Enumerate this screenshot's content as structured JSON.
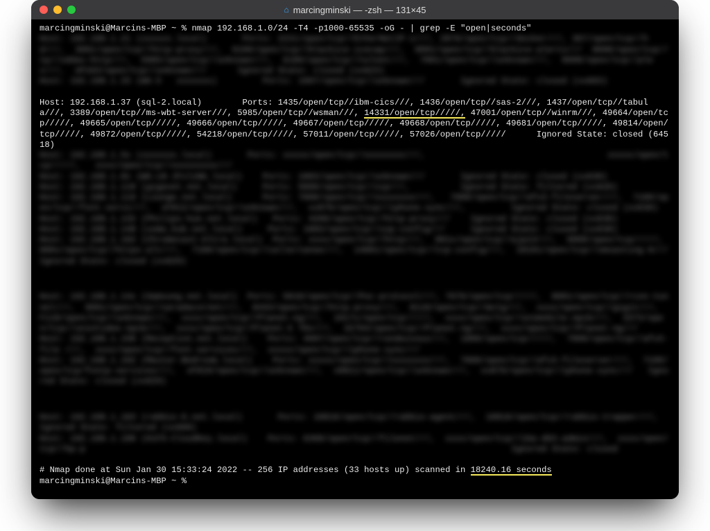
{
  "window": {
    "title": "marcingminski — -zsh — 131×45"
  },
  "terminal": {
    "prompt1_user": "marcingminski@Marcins-MBP ~ %",
    "command": "nmap 192.168.1.0/24 -T4 -p1000-65535 -oG - | grep -E \"open|seconds\"",
    "blurred1": "Host: 192.168.1.21 (xxxxxx.local)       Ports: 2221/open/tcp//EtherNetIP-1///, 2876/open/tcp//docker///, 367/open/tcp//hd///,  3001/open/tcp//http-proxy///,  6100/open/tcp//blackice-icecap///,  9091/open/tcp//blackice-alerts///  8008/open/tcp//tp//vddav-http///,  5985/open/tcp//unknown///,  6180/open/tcp//telnet///,  7001/open/tcp//unknown///,  8008/open/tcp//plex///,  eP163/open/tcp//unknown///      Ignored State: closed (xx623)\nHost: 192.168.1.33 (WG-5   xxxxxxx)         Ports: 1997/open/tcp//unknown///       Ignored State: closed (xx603)",
    "clear_host_line_part1": "Host: 192.168.1.37 (sql-2.local)        Ports: 1435/open/tcp//ibm-cics///, 1436/open/tcp//sas-2///, 1437/open/tcp//tabula///, 3389/open/tcp//ms-wbt-server///, 5985/open/tcp//wsman///,",
    "clear_host_hl1": "14331/open/tcp/////,",
    "clear_host_line_part2": "47001/open/tcp//winrm///, 49664/open/tcp/////, 49665/open/tcp/////, 49666/open/tcp/////, 49667/open/tcp/////, 49668/open/tcp/////, 49681/open/tcp/////, 49814/open/tcp/////, 49872/open/tcp/////, 54218/open/tcp/////, 57011/open/tcp/////, 57026/open/tcp/////      Ignored State: closed (64518)",
    "blurred2": "Host: 192.168.1.5x (xxxxxxx.local)       Ports: xxxxx/open/tcp//xxxxxxxx///,                                    xxxxx/open/tcp/////,   xxxx/open/tcp//xxxxxxxxx///\nHost: 192.168.1.8x (WG-LB-JFxlzNA.local)    Ports: 1883/open/tcp//unknown///       Ignored State: closed (xx638)\nHost: 192.168.1.118 (gigaset.net.local)     Ports: 5060/open/tcp//sip///,          Ignored State: filtered (xx620)\nHost: 192.168.1.119 (Lounge.net.local)      Ports: 7000/open/tcp//xxxxxxxx///,   7000/open/tcp//afx3-fileserver///,  7100/open/tcp//font-servi///,  xF812/open/tcp//unknown///,  xx876/open/tcp//iphone-sync///,         Ignored State: closed (xx630)\nHost: 192.168.1.132 (Philips-hue.net.local)   Ports: 4200/open/tcp//http-proxy///    Ignored State: closed (xx638)\nHost: 192.168.1.148 (some_hub.net.local)     Ports: 1883/open/tcp//ssp-config///     Ignored State: closed (xx638)\nHost: 192.168.1.162 (Chromecast-Ultra.local)  Ports: xxxx/open/tcp//http///,  801x/open/tcp//ajp13///,  9000/open/tcp/////,       800x/open/tcp//https-alt///,  7100/open/tcp//callertanee///,  14001/open/tcp//tcp-config///,  18101/open/tcp//smsasting-9///   Ignored State: closed (xx629)",
    "blurred3": "Host: 192.168.1.14x (Samsung.net.local)  Ports: 5618/open/tcp//Poc-protocol///, 7676/open/tcp/////,  8001/open/tcp//rcon-tunnel///,  9091/open/tcp//saradacornet///,  8443/open/tcp//http-proxy///,  8110/open/tcp//mctg///,  xxxx/open/tcp//gigit///,  F118/open/tcp//unknown///,  xxxx/open/tcp//Planet-ng///,  1017x/open/tcp/////,  xxxx/open/tcp//unimobile-npcb///,  3373/open/tcp//unintidee-npcb///,  xxxx/open/tcp//Planet-k T6x///,  32764/open/tcp//Planet-ng///,  xxxx/open/tcp//Planet-ng///\nHost: 192.168.1.158 (Reception.net.local)    Ports: 4997/open/tcp//rendezvous///,  1800/open/tcp/////,  7000/open/tcp//afx3-file ///,  xxxx/open/tcp//font-services///,  xxxxx/open/tcp//iphone-sync///\nHost: 192.168.1.162 (Master-Bedroom.local)    Ports: xxxxx/open/tcp//xxxxxxxx///,  7000/open/tcp//afx3-fileserver///,  7100/open/tcp/fontp-services///,  xF810/open/tcp//unknown///,  x8811/open/tcp//unknown///,  xx876/open/tcp//iphone-sync///   Ignored State: closed (xx629)",
    "blurred4": "Host: 192.168.1.163 (rabbio-6.net.local)       Ports: 18816/open/tcp//rabbio-agent///,  18816/open/tcp//rabbio-trapper///,    Ignored State: filtered (xx608)\nHost: 192.168.1.188 (HiFS-CloudKey.local)    Ports: 6368/open/tcp//filenet///,  xxxx/open/tcp//iba-d63-admin///,  xxxx/open/tcp//hp-p                                                                                    Ignored State: closed   ",
    "nmap_done_pre": "# Nmap done at Sun Jan 30 15:33:24 2022 -- 256 IP addresses (33 hosts up) scanned in ",
    "nmap_done_hl": "18240.16 seconds",
    "prompt2_user": "marcingminski@Marcins-MBP ~ %"
  }
}
